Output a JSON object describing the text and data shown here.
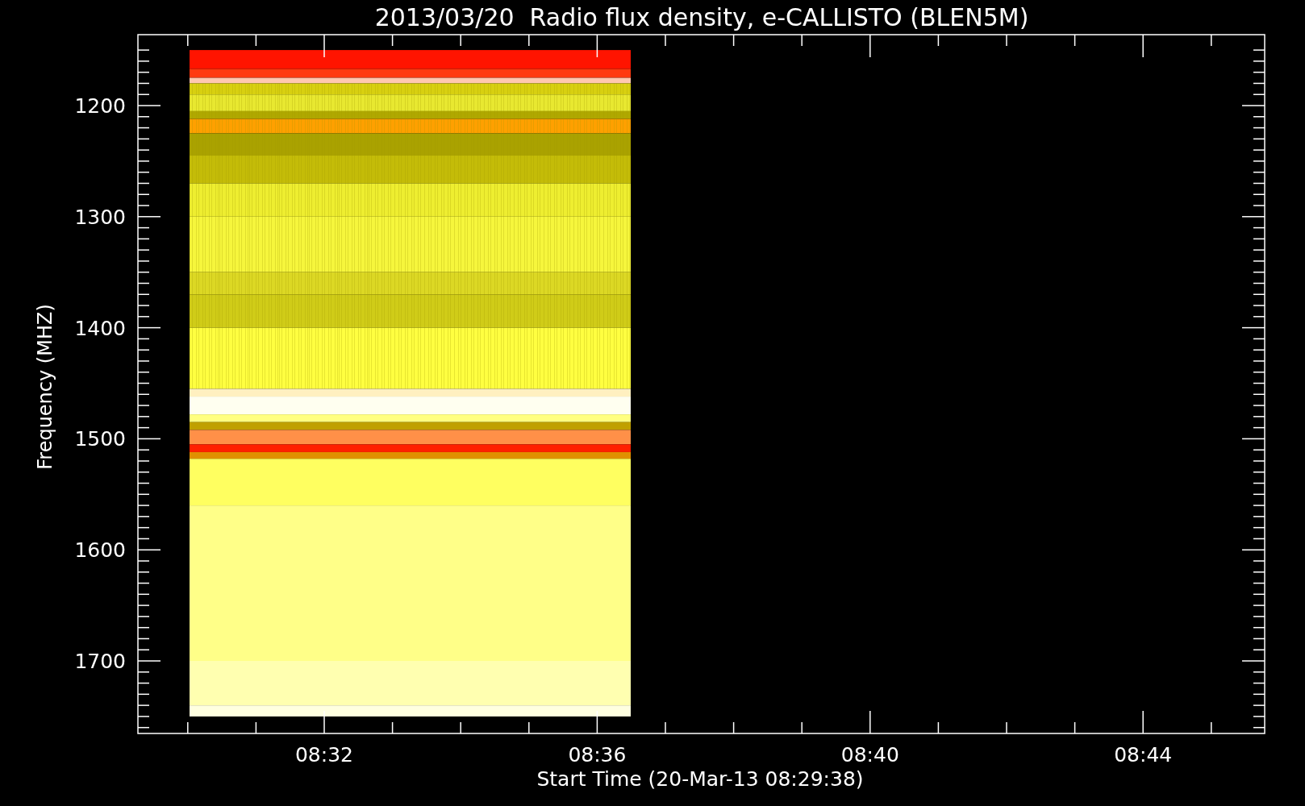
{
  "title": "2013/03/20  Radio flux density, e-CALLISTO (BLEN5M)",
  "ylabel": "Frequency (MHZ)",
  "xlabel": "Start Time (20-Mar-13 08:29:38)",
  "yticks": [
    "1200",
    "1300",
    "1400",
    "1500",
    "1600",
    "1700"
  ],
  "xticks": [
    "08:32",
    "08:36",
    "08:40",
    "08:44"
  ]
}
